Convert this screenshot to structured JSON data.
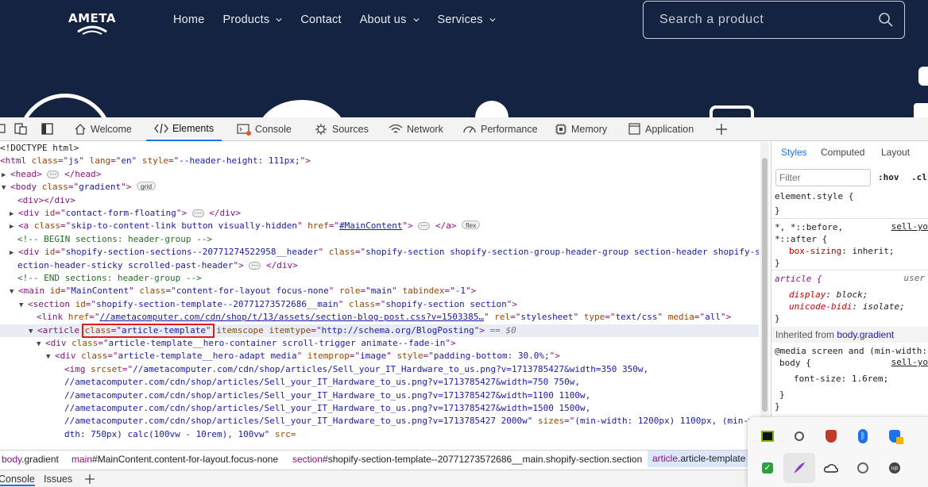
{
  "site": {
    "logo_text": "AMETA",
    "nav": [
      {
        "label": "Home",
        "has_dropdown": false
      },
      {
        "label": "Products",
        "has_dropdown": true
      },
      {
        "label": "Contact",
        "has_dropdown": false
      },
      {
        "label": "About us",
        "has_dropdown": true
      },
      {
        "label": "Services",
        "has_dropdown": true
      }
    ],
    "search_placeholder": "Search a product",
    "colors": {
      "header_bg": "#14233f",
      "nav_text": "#e8ecf3"
    }
  },
  "devtools": {
    "tabs": [
      {
        "label": "Welcome",
        "icon": "home-icon"
      },
      {
        "label": "Elements",
        "icon": "code-icon",
        "active": true
      },
      {
        "label": "Console",
        "icon": "console-icon"
      },
      {
        "label": "Sources",
        "icon": "sources-icon"
      },
      {
        "label": "Network",
        "icon": "wifi-icon"
      },
      {
        "label": "Performance",
        "icon": "performance-icon"
      },
      {
        "label": "Memory",
        "icon": "memory-icon"
      },
      {
        "label": "Application",
        "icon": "application-icon"
      }
    ],
    "dom": {
      "doctype": "<!DOCTYPE html>",
      "html_open": "html",
      "html_attrs": [
        [
          "class",
          "js"
        ],
        [
          "lang",
          "en"
        ],
        [
          "style",
          "--header-height: 111px;"
        ]
      ],
      "head": "head",
      "body_class": "gradient",
      "grid_pill": "grid",
      "flex_pill": "flex",
      "div_empty": "div",
      "contact_id": "contact-form-floating",
      "skip_class": "skip-to-content-link button visually-hidden",
      "skip_href": "#MainContent",
      "comment_begin": "<!-- BEGIN sections: header-group -->",
      "header_id": "shopify-section-sections--20771274522958__header",
      "header_class_1": "shopify-section shopify-section-group-header-group section-header shopify-s",
      "header_class_2": "ection-header-sticky scrolled-past-header",
      "comment_end": "<!-- END sections: header-group -->",
      "main_id": "MainContent",
      "main_class": "content-for-layout focus-none",
      "main_role": "main",
      "main_tabindex": "-1",
      "section_id": "shopify-section-template--20771273572686__main",
      "section_class": "shopify-section section",
      "link_href": "//ametacomputer.com/cdn/shop/t/13/assets/section-blog-post.css?v=1503385…",
      "link_rel": "stylesheet",
      "link_type": "text/css",
      "link_media": "all",
      "article_class": "article-template",
      "article_itemtype": "http://schema.org/BlogPosting",
      "eq0": "== $0",
      "hero_class": "article-template__hero-container scroll-trigger animate--fade-in",
      "adapt_class": "article-template__hero-adapt media",
      "adapt_itemprop": "image",
      "adapt_style": "padding-bottom: 30.0%;",
      "img_srcset_1": "//ametacomputer.com/cdn/shop/articles/Sell_your_IT_Hardware_to_us.png?v=1713785427&width=350 350w,",
      "img_srcset_2": "//ametacomputer.com/cdn/shop/articles/Sell_your_IT_Hardware_to_us.png?v=1713785427&width=750 750w,",
      "img_srcset_3": "//ametacomputer.com/cdn/shop/articles/Sell_your_IT_Hardware_to_us.png?v=1713785427&width=1100 1100w,",
      "img_srcset_4": "//ametacomputer.com/cdn/shop/articles/Sell_your_IT_Hardware_to_us.png?v=1713785427&width=1500 1500w,",
      "img_srcset_5a": "//ametacomputer.com/cdn/shop/articles/Sell_your_IT_Hardware_to_us.png?v=1713785427 2000w\"",
      "img_sizes_a": "(min-width: 1200px) 1100px, (min-w",
      "img_sizes_b": "dth: 750px) calc(100vw - 10rem), 100vw\"",
      "img_src": " src="
    },
    "styles": {
      "tabs": [
        "Styles",
        "Computed",
        "Layout"
      ],
      "filter_placeholder": "Filter",
      "hov": ":hov",
      "cls": ".cls",
      "element_style": "element.style {",
      "close_brace": "}",
      "univ_sel_1": "*, *::before,",
      "univ_sel_2": "*::after {",
      "univ_src": "sell-yo",
      "box_sizing_prop": "box-sizing",
      "box_sizing_val": "inherit;",
      "article_sel": "article {",
      "article_src": "user",
      "display_prop": "display",
      "display_val": "block;",
      "unicode_prop": "unicode-bidi",
      "unicode_val": "isolate;",
      "inherited_label": "Inherited from",
      "inherited_from": "body.gradient",
      "media_line": "@media screen and (min-width:",
      "body_sel": "body {",
      "body_src": "sell-yo",
      "font_size_prop": "font-size",
      "font_size_val": "1.6rem;"
    },
    "breadcrumbs": [
      {
        "tag": "body",
        "rest": ".gradient"
      },
      {
        "tag": "main",
        "rest": "#MainContent.content-for-layout.focus-none"
      },
      {
        "tag": "section",
        "rest": "#shopify-section-template--20771273572686__main.shopify-section.section"
      },
      {
        "tag": "article",
        "rest": ".article-template"
      }
    ],
    "drawer_tabs": [
      "Console",
      "Issues"
    ]
  },
  "tray": {
    "icons": [
      "nvidia-icon",
      "record-icon",
      "security-shield-icon",
      "bluetooth-icon",
      "warning-shield-icon",
      "check-shield-icon",
      "feather-icon",
      "cloud-icon",
      "update-icon",
      "upwork-icon"
    ]
  }
}
